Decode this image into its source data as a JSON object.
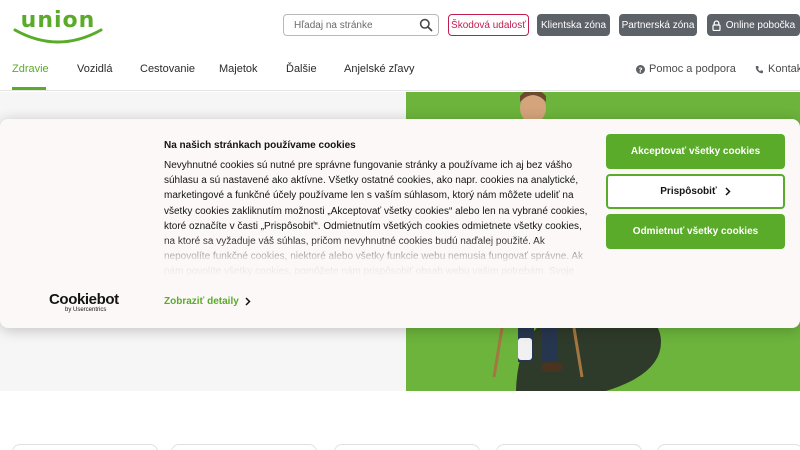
{
  "brand": {
    "logo_text": "union",
    "accent": "#5bab2a",
    "danger": "#c21d4f",
    "grey_button": "#5d6268"
  },
  "header": {
    "search_placeholder": "Hľadaj na stránke",
    "search_icon": "search-icon",
    "claim_label": "Škodová udalosť",
    "client_label": "Klientska zóna",
    "partner_label": "Partnerská zóna",
    "online_label": "Online pobočka",
    "online_icon": "lock-icon"
  },
  "nav": {
    "items": [
      {
        "label": "Zdravie",
        "active": true
      },
      {
        "label": "Vozidlá"
      },
      {
        "label": "Cestovanie"
      },
      {
        "label": "Majetok"
      },
      {
        "label": "Ďalšie"
      },
      {
        "label": "Anjelské zľavy"
      }
    ],
    "help_label": "Pomoc a podpora",
    "help_icon": "question-circle-icon",
    "contact_label": "Kontakt",
    "contact_icon": "phone-icon"
  },
  "cookie": {
    "title": "Na našich stránkach používame cookies",
    "body": "Nevyhnutné cookies sú nutné pre správne fungovanie stránky a používame ich aj bez vášho súhlasu a sú nastavené ako aktívne. Všetky ostatné cookies, ako napr. cookies na analytické, marketingové a funkčné účely používame len s vaším súhlasom, ktorý nám môžete udeliť na všetky cookies zakliknutím možnosti „Akceptovať všetky cookies“ alebo len na vybrané cookies, ktoré označíte v časti „Prispôsobiť“. Odmietnutím všetkých cookies odmietnete všetky cookies, na ktoré sa vyžaduje váš súhlas, pričom nevyhnutné cookies budú naďalej použité. Ak nepovolíte funkčné cookies, niektoré alebo všetky funkcie webu nemusia fungovať správne. Ak nám povolíte všetky cookies, pomôžete nám prispôsobiť obsah webu vašim potrebám. Svoje",
    "details_label": "Zobraziť detaily",
    "accept_label": "Akceptovať všetky cookies",
    "customize_label": "Prispôsobiť",
    "deny_label": "Odmietnuť všetky cookies",
    "provider_logo_main": "Cookiebot",
    "provider_logo_sub": "by Usercentrics"
  }
}
